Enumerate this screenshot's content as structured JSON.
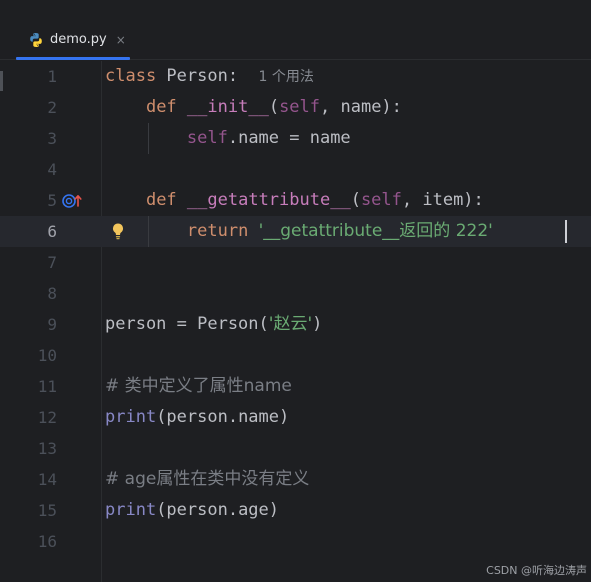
{
  "tab": {
    "filename": "demo.py",
    "close_glyph": "×",
    "icon": "python-icon"
  },
  "gutter": {
    "override_icon": "override-up-icon",
    "bulb_icon": "lightbulb-icon"
  },
  "lines": [
    {
      "n": "1",
      "parts": {
        "kw": "class",
        "rest": " Person:  ",
        "hint": "1 个用法"
      }
    },
    {
      "n": "2",
      "parts": {
        "indent": "    ",
        "kw": "def",
        "sp": " ",
        "fn": "__init__",
        "p1": "(",
        "self": "self",
        "rest": ", name):"
      }
    },
    {
      "n": "3",
      "parts": {
        "indent": "        ",
        "self": "self",
        "rest": ".name = name"
      }
    },
    {
      "n": "4",
      "parts": {}
    },
    {
      "n": "5",
      "parts": {
        "indent": "    ",
        "kw": "def",
        "sp": " ",
        "fn": "__getattribute__",
        "p1": "(",
        "self": "self",
        "rest": ", item):"
      }
    },
    {
      "n": "6",
      "parts": {
        "indent": "        ",
        "kw": "return",
        "sp": " ",
        "str": "'__getattribute__返回的 222'"
      }
    },
    {
      "n": "7",
      "parts": {}
    },
    {
      "n": "8",
      "parts": {}
    },
    {
      "n": "9",
      "parts": {
        "rest": "person = Person(",
        "str": "'赵云'",
        "rest2": ")"
      }
    },
    {
      "n": "10",
      "parts": {}
    },
    {
      "n": "11",
      "parts": {
        "cm": "# 类中定义了属性name"
      }
    },
    {
      "n": "12",
      "parts": {
        "bi": "print",
        "rest": "(person.name)"
      }
    },
    {
      "n": "13",
      "parts": {}
    },
    {
      "n": "14",
      "parts": {
        "cm": "# age属性在类中没有定义"
      }
    },
    {
      "n": "15",
      "parts": {
        "bi": "print",
        "rest": "(person.age)"
      }
    },
    {
      "n": "16",
      "parts": {}
    }
  ],
  "watermark": "CSDN @听海边涛声",
  "colors": {
    "background": "#1e1f22",
    "keyword": "#cf8e6d",
    "dunder_function": "#c77dbb",
    "self": "#94558d",
    "builtin": "#8888c6",
    "string": "#6aab73",
    "comment": "#7a7e85",
    "accent": "#3574f0"
  }
}
